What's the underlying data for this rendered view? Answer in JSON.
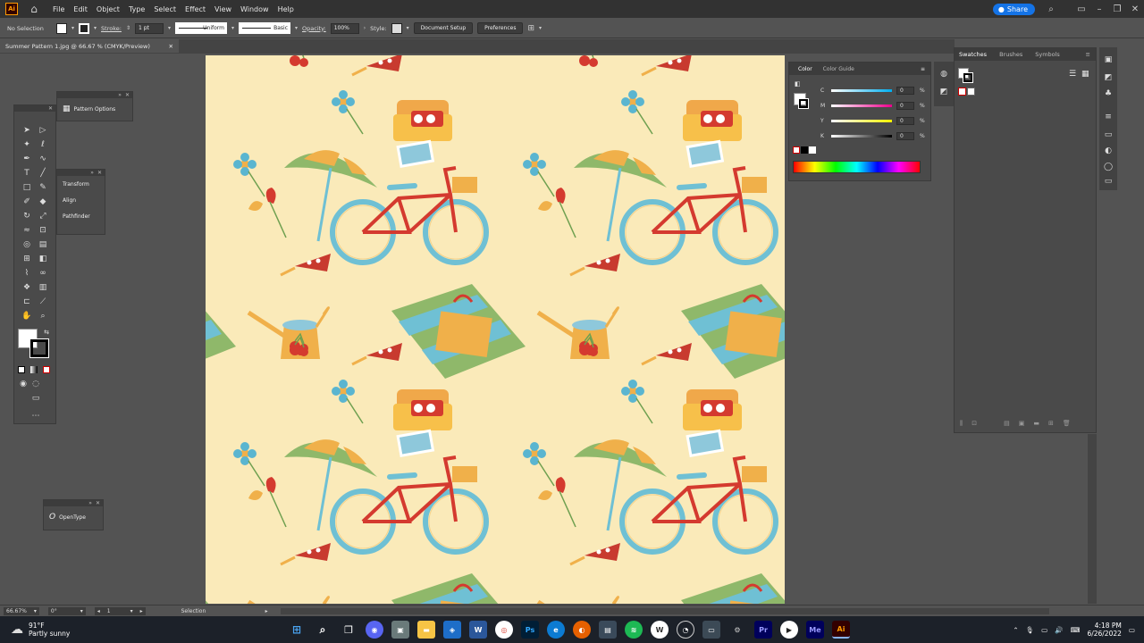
{
  "app": {
    "logo": "Ai",
    "menus": [
      "File",
      "Edit",
      "Object",
      "Type",
      "Select",
      "Effect",
      "View",
      "Window",
      "Help"
    ],
    "share_label": "Share"
  },
  "control_bar": {
    "selection_status": "No Selection",
    "stroke_label": "Stroke:",
    "stroke_weight": "1 pt",
    "profile_label": "Uniform",
    "brush_label": "Basic",
    "opacity_label": "Opacity:",
    "opacity_value": "100%",
    "style_label": "Style:",
    "document_setup_label": "Document Setup",
    "preferences_label": "Preferences"
  },
  "document": {
    "tab_title": "Summer Pattern 1.jpg @ 66.67 % (CMYK/Preview)"
  },
  "floating_panels": {
    "pattern_options": "Pattern Options",
    "transform": "Transform",
    "align": "Align",
    "pathfinder": "Pathfinder",
    "opentype": "OpenType"
  },
  "color_panel": {
    "tabs": [
      "Color",
      "Color Guide"
    ],
    "sliders": [
      {
        "label": "C",
        "value": "0",
        "unit": "%",
        "gradient": "linear-gradient(to right, #fff, #00aeef)"
      },
      {
        "label": "M",
        "value": "0",
        "unit": "%",
        "gradient": "linear-gradient(to right, #fff, #ec008c)"
      },
      {
        "label": "Y",
        "value": "0",
        "unit": "%",
        "gradient": "linear-gradient(to right, #fff, #fff200)"
      },
      {
        "label": "K",
        "value": "0",
        "unit": "%",
        "gradient": "linear-gradient(to right, #fff, #000)"
      }
    ]
  },
  "swatches_panel": {
    "tabs": [
      "Swatches",
      "Brushes",
      "Symbols"
    ]
  },
  "status_bar": {
    "zoom": "66.67%",
    "rotation": "0°",
    "artboard": "1",
    "tool": "Selection"
  },
  "taskbar": {
    "weather_temp": "91°F",
    "weather_desc": "Partly sunny",
    "time": "4:18 PM",
    "date": "6/26/2022"
  },
  "colors": {
    "canvas_bg": "#faeab9",
    "accent_blue": "#1473e6",
    "ui_dark": "#323232",
    "ui_mid": "#535353"
  }
}
